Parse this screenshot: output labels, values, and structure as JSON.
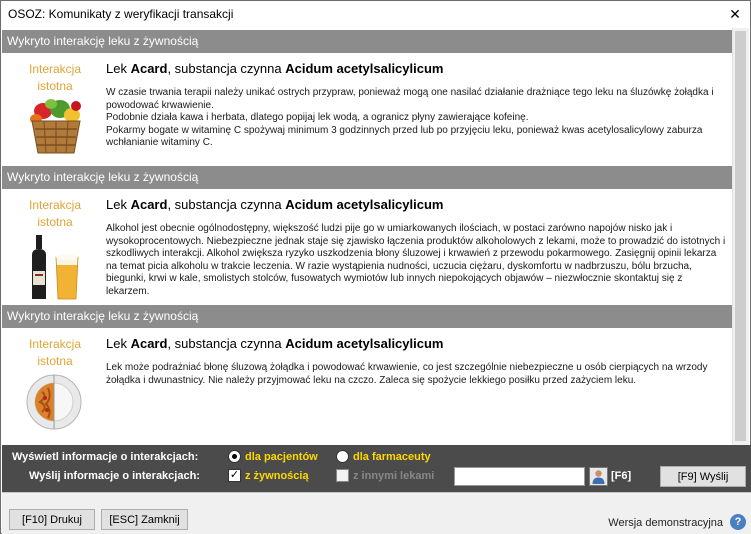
{
  "window": {
    "title": "OSOZ: Komunikaty z weryfikacji transakcji",
    "close_glyph": "✕"
  },
  "sections": [
    {
      "header": "Wykryto interakcję leku z żywnością",
      "badge_line1": "Interakcja",
      "badge_line2": "istotna",
      "title_prefix": "Lek ",
      "drug": "Acard",
      "title_mid": ", substancja czynna ",
      "substance": "Acidum acetylsalicylicum",
      "text": "W czasie trwania terapii należy unikać ostrych przypraw, ponieważ mogą one nasilać działanie drażniące tego leku na śluzówkę żołądka i powodować krwawienie.\nPodobnie działa kawa i herbata, dlatego popijaj  lek wodą, a ogranicz płyny zawierające kofeinę.\nPokarmy bogate w witaminę C spożywaj minimum 3 godzinnych przed lub po przyjęciu leku, ponieważ kwas acetylosalicylowy zaburza wchłanianie witaminy C.",
      "illustration": "vegetable-basket-icon"
    },
    {
      "header": "Wykryto interakcję leku z żywnością",
      "badge_line1": "Interakcja",
      "badge_line2": "istotna",
      "title_prefix": "Lek ",
      "drug": "Acard",
      "title_mid": ", substancja czynna ",
      "substance": "Acidum acetylsalicylicum",
      "text": "Alkohol jest obecnie ogólnodostępny, większość ludzi pije go w umiarkowanych ilościach, w postaci zarówno napojów nisko jak i wysokoprocentowych. Niebezpieczne jednak staje się zjawisko łączenia produktów alkoholowych z lekami, może to prowadzić do istotnych i szkodliwych interakcji. Alkohol zwiększa ryzyko uszkodzenia błony śluzowej i krwawień z przewodu pokarmowego. Zasięgnij opinii lekarza na temat picia alkoholu w trakcie leczenia. W razie wystąpienia nudności, uczucia ciężaru, dyskomfortu w nadbrzuszu, bólu brzucha, biegunki, krwi w kale, smolistych stolców, fusowatych wymiotów lub innych niepokojących objawów – niezwłocznie skontaktuj się z lekarzem.",
      "illustration": "wine-beer-icon"
    },
    {
      "header": "Wykryto interakcję leku z żywnością",
      "badge_line1": "Interakcja",
      "badge_line2": "istotna",
      "title_prefix": "Lek ",
      "drug": "Acard",
      "title_mid": ", substancja czynna ",
      "substance": "Acidum acetylsalicylicum",
      "text": "Lek może podrażniać błonę śluzową żołądka i powodować krwawienie, co jest szczególnie niebezpieczne u osób cierpiących na wrzody żołądka i dwunastnicy. Nie należy przyjmować leku na czczo. Zaleca się spożycie lekkiego posiłku przed zażyciem leku.",
      "illustration": "half-plate-icon"
    }
  ],
  "options": {
    "show_label": "Wyświetl informacje o  interakcjach:",
    "patients_label": "dla pacjentów",
    "pharmacist_label": "dla farmaceuty",
    "send_label": "Wyślij informacje o  interakcjach:",
    "food_label": "z żywnością",
    "other_drugs_label": "z innymi lekami",
    "check_glyph": "✓",
    "f6_label": "[F6]",
    "send_button": "[F9] Wyślij",
    "selected_audience": "dla pacjentów",
    "food_checked": true,
    "other_drugs_checked": false,
    "input_value": ""
  },
  "footer": {
    "print_button": "[F10] Drukuj",
    "close_button": "[ESC] Zamknij",
    "demo_label": "Wersja demonstracyjna",
    "help_glyph": "?"
  },
  "colors": {
    "section_header": "#8c8c8c",
    "badge_text": "#e0a437",
    "bottom_panel": "#4b4b4b",
    "option_highlight": "#ffd800"
  }
}
